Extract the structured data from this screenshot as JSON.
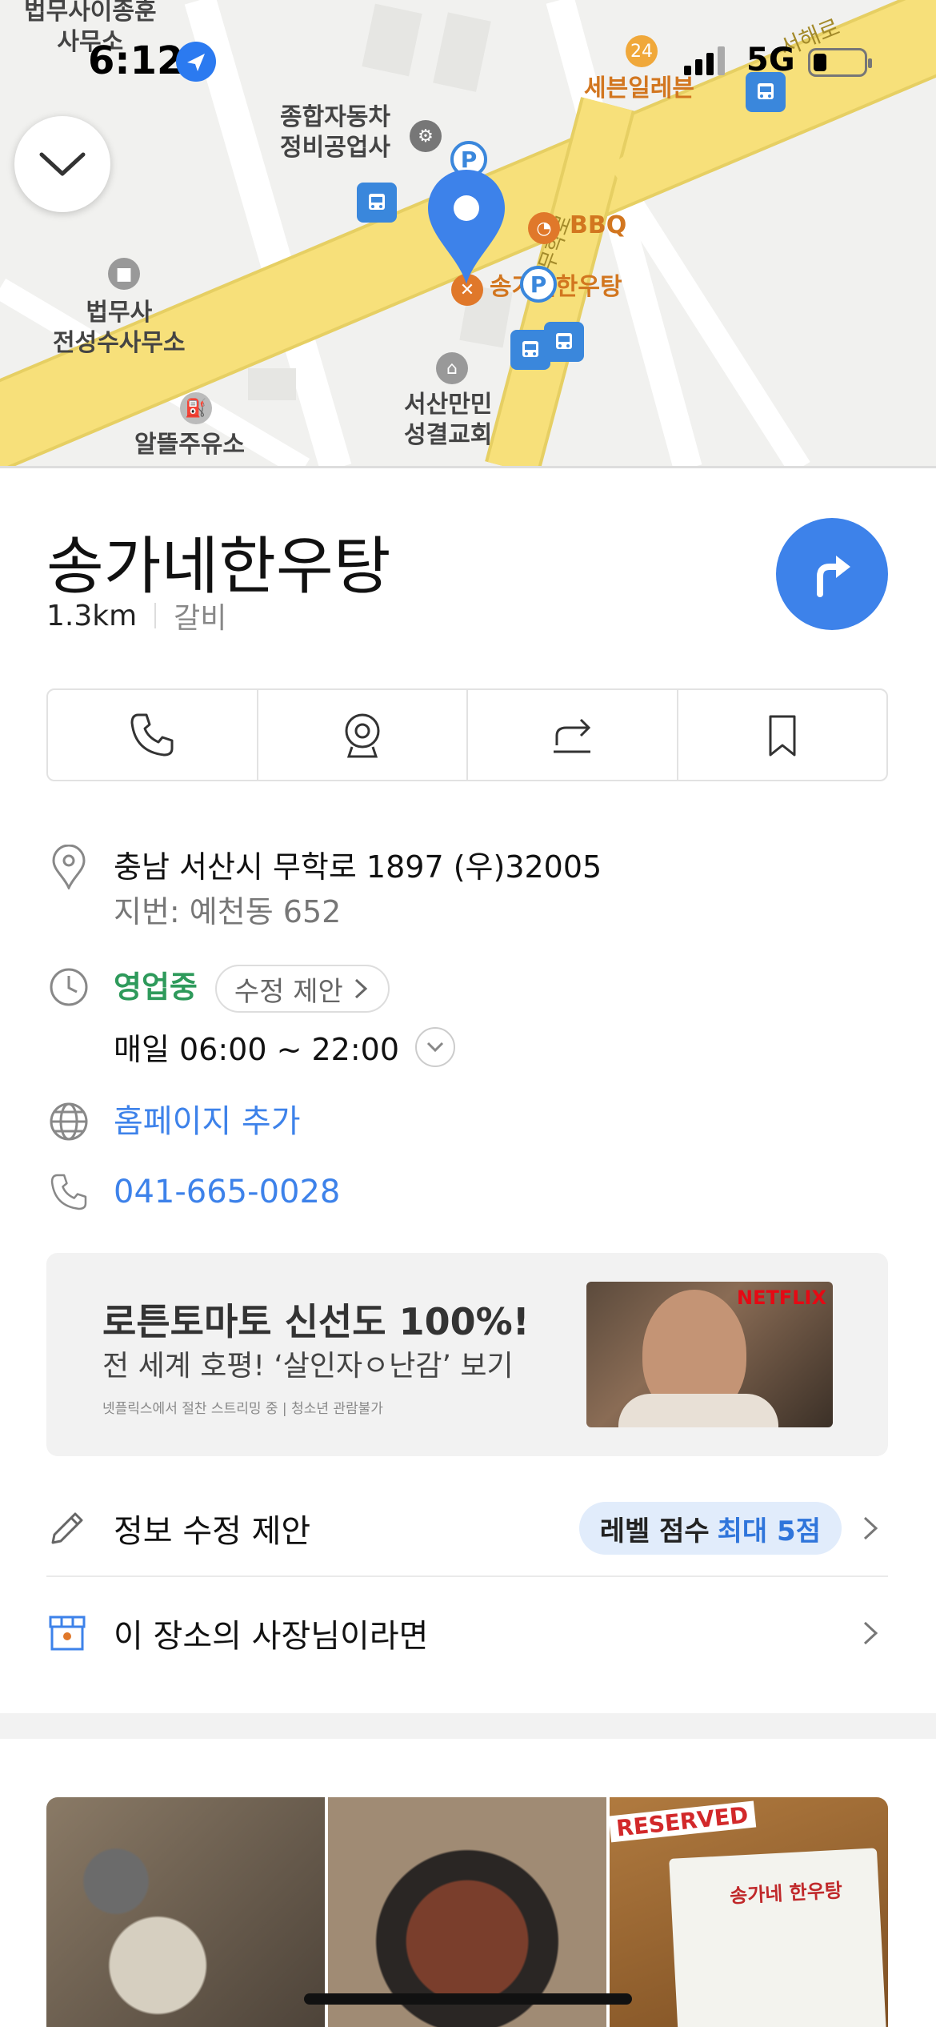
{
  "status_bar": {
    "time": "6:12",
    "network": "5G"
  },
  "map": {
    "labels": [
      {
        "text": "법무사이종훈\n사무소",
        "color": "dark"
      },
      {
        "text": "종합자동차\n정비공업사",
        "color": "dark"
      },
      {
        "text": "세븐일레븐",
        "color": "orange"
      },
      {
        "text": "BBQ",
        "color": "orange"
      },
      {
        "text": "송가네한우탕",
        "color": "orange"
      },
      {
        "text": "법무사\n전성수사무소",
        "color": "dark"
      },
      {
        "text": "서산만민\n성결교회",
        "color": "dark"
      },
      {
        "text": "알뜰주유소",
        "color": "dark"
      }
    ],
    "road_labels": [
      "서해로",
      "무학로"
    ],
    "parking_label": "P"
  },
  "place": {
    "name": "송가네한우탕",
    "distance": "1.3km",
    "category": "갈비",
    "address": "충남 서산시 무학로 1897 (우)32005",
    "lot_address": "지번: 예천동 652",
    "open_status": "영업중",
    "suggest_edit_pill": "수정 제안",
    "hours": "매일 06:00 ~ 22:00",
    "homepage_add": "홈페이지 추가",
    "phone": "041-665-0028"
  },
  "ad": {
    "headline": "로튼토마토 신선도 100%!",
    "subline": "전 세계 호평! ‘살인자ㅇ난감’ 보기",
    "fine_print": "넷플릭스에서 절찬 스트리밍 중 | 청소년 관람불가",
    "brand": "NETFLIX"
  },
  "edit_info": {
    "label": "정보 수정 제안",
    "badge_prefix": "레벨 점수",
    "badge_highlight": "최대 5점"
  },
  "owner": {
    "label": "이 장소의 사장님이라면"
  },
  "photos": {
    "card_text": "송가네 한우탕",
    "reserved": "RESERVED"
  },
  "colors": {
    "accent": "#3d82ea",
    "open": "#2e9a5b",
    "road": "#f7e07a"
  }
}
